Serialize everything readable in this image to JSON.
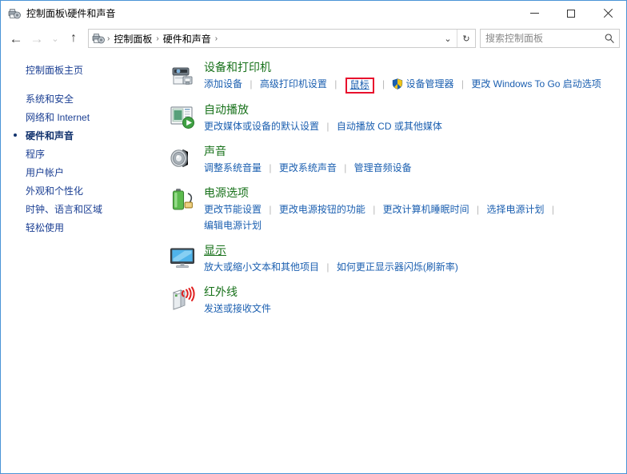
{
  "window": {
    "title": "控制面板\\硬件和声音",
    "title_icon": "control-panel-icon",
    "minimize_label": "最小化",
    "maximize_label": "最大化",
    "close_label": "关闭"
  },
  "navbar": {
    "back_label": "后退",
    "forward_label": "前进",
    "recent_label": "最近浏览的位置",
    "up_label": "上移一级",
    "breadcrumbs": [
      "控制面板",
      "硬件和声音"
    ],
    "separator": "›",
    "dropdown_label": "历史记录",
    "refresh_label": "刷新",
    "refresh_glyph": "↻"
  },
  "search": {
    "placeholder": "搜索控制面板",
    "value": "",
    "icon": "search-icon"
  },
  "sidebar": {
    "home": "控制面板主页",
    "items": [
      {
        "label": "系统和安全",
        "selected": false
      },
      {
        "label": "网络和 Internet",
        "selected": false
      },
      {
        "label": "硬件和声音",
        "selected": true
      },
      {
        "label": "程序",
        "selected": false
      },
      {
        "label": "用户帐户",
        "selected": false
      },
      {
        "label": "外观和个性化",
        "selected": false
      },
      {
        "label": "时钟、语言和区域",
        "selected": false
      },
      {
        "label": "轻松使用",
        "selected": false
      }
    ]
  },
  "categories": [
    {
      "id": "devices-printers",
      "title": "设备和打印机",
      "title_underlined": false,
      "icon": "printer-icon",
      "links": [
        {
          "label": "添加设备",
          "shield": false,
          "highlight": false
        },
        {
          "label": "高级打印机设置",
          "shield": false,
          "highlight": false
        },
        {
          "label": "鼠标",
          "shield": false,
          "highlight": true
        },
        {
          "label": "设备管理器",
          "shield": true,
          "highlight": false
        },
        {
          "label": "更改 Windows To Go 启动选项",
          "shield": false,
          "highlight": false
        }
      ]
    },
    {
      "id": "autoplay",
      "title": "自动播放",
      "title_underlined": false,
      "icon": "autoplay-icon",
      "links": [
        {
          "label": "更改媒体或设备的默认设置",
          "shield": false,
          "highlight": false
        },
        {
          "label": "自动播放 CD 或其他媒体",
          "shield": false,
          "highlight": false
        }
      ]
    },
    {
      "id": "sound",
      "title": "声音",
      "title_underlined": false,
      "icon": "speaker-icon",
      "links": [
        {
          "label": "调整系统音量",
          "shield": false,
          "highlight": false
        },
        {
          "label": "更改系统声音",
          "shield": false,
          "highlight": false
        },
        {
          "label": "管理音频设备",
          "shield": false,
          "highlight": false
        }
      ]
    },
    {
      "id": "power-options",
      "title": "电源选项",
      "title_underlined": false,
      "icon": "battery-icon",
      "links": [
        {
          "label": "更改节能设置",
          "shield": false,
          "highlight": false
        },
        {
          "label": "更改电源按钮的功能",
          "shield": false,
          "highlight": false
        },
        {
          "label": "更改计算机睡眠时间",
          "shield": false,
          "highlight": false
        },
        {
          "label": "选择电源计划",
          "shield": false,
          "highlight": false
        },
        {
          "label": "编辑电源计划",
          "shield": false,
          "highlight": false
        }
      ]
    },
    {
      "id": "display",
      "title": "显示",
      "title_underlined": true,
      "icon": "monitor-icon",
      "links": [
        {
          "label": "放大或缩小文本和其他项目",
          "shield": false,
          "highlight": false
        },
        {
          "label": "如何更正显示器闪烁(刷新率)",
          "shield": false,
          "highlight": false
        }
      ]
    },
    {
      "id": "infrared",
      "title": "红外线",
      "title_underlined": false,
      "icon": "infrared-icon",
      "links": [
        {
          "label": "发送或接收文件",
          "shield": false,
          "highlight": false
        }
      ]
    }
  ],
  "colors": {
    "category_title": "#17711a",
    "link": "#1b5fb0",
    "sidebar_link": "#1b3f93",
    "highlight_box": "#e8112d",
    "window_border": "#4a94d6"
  }
}
